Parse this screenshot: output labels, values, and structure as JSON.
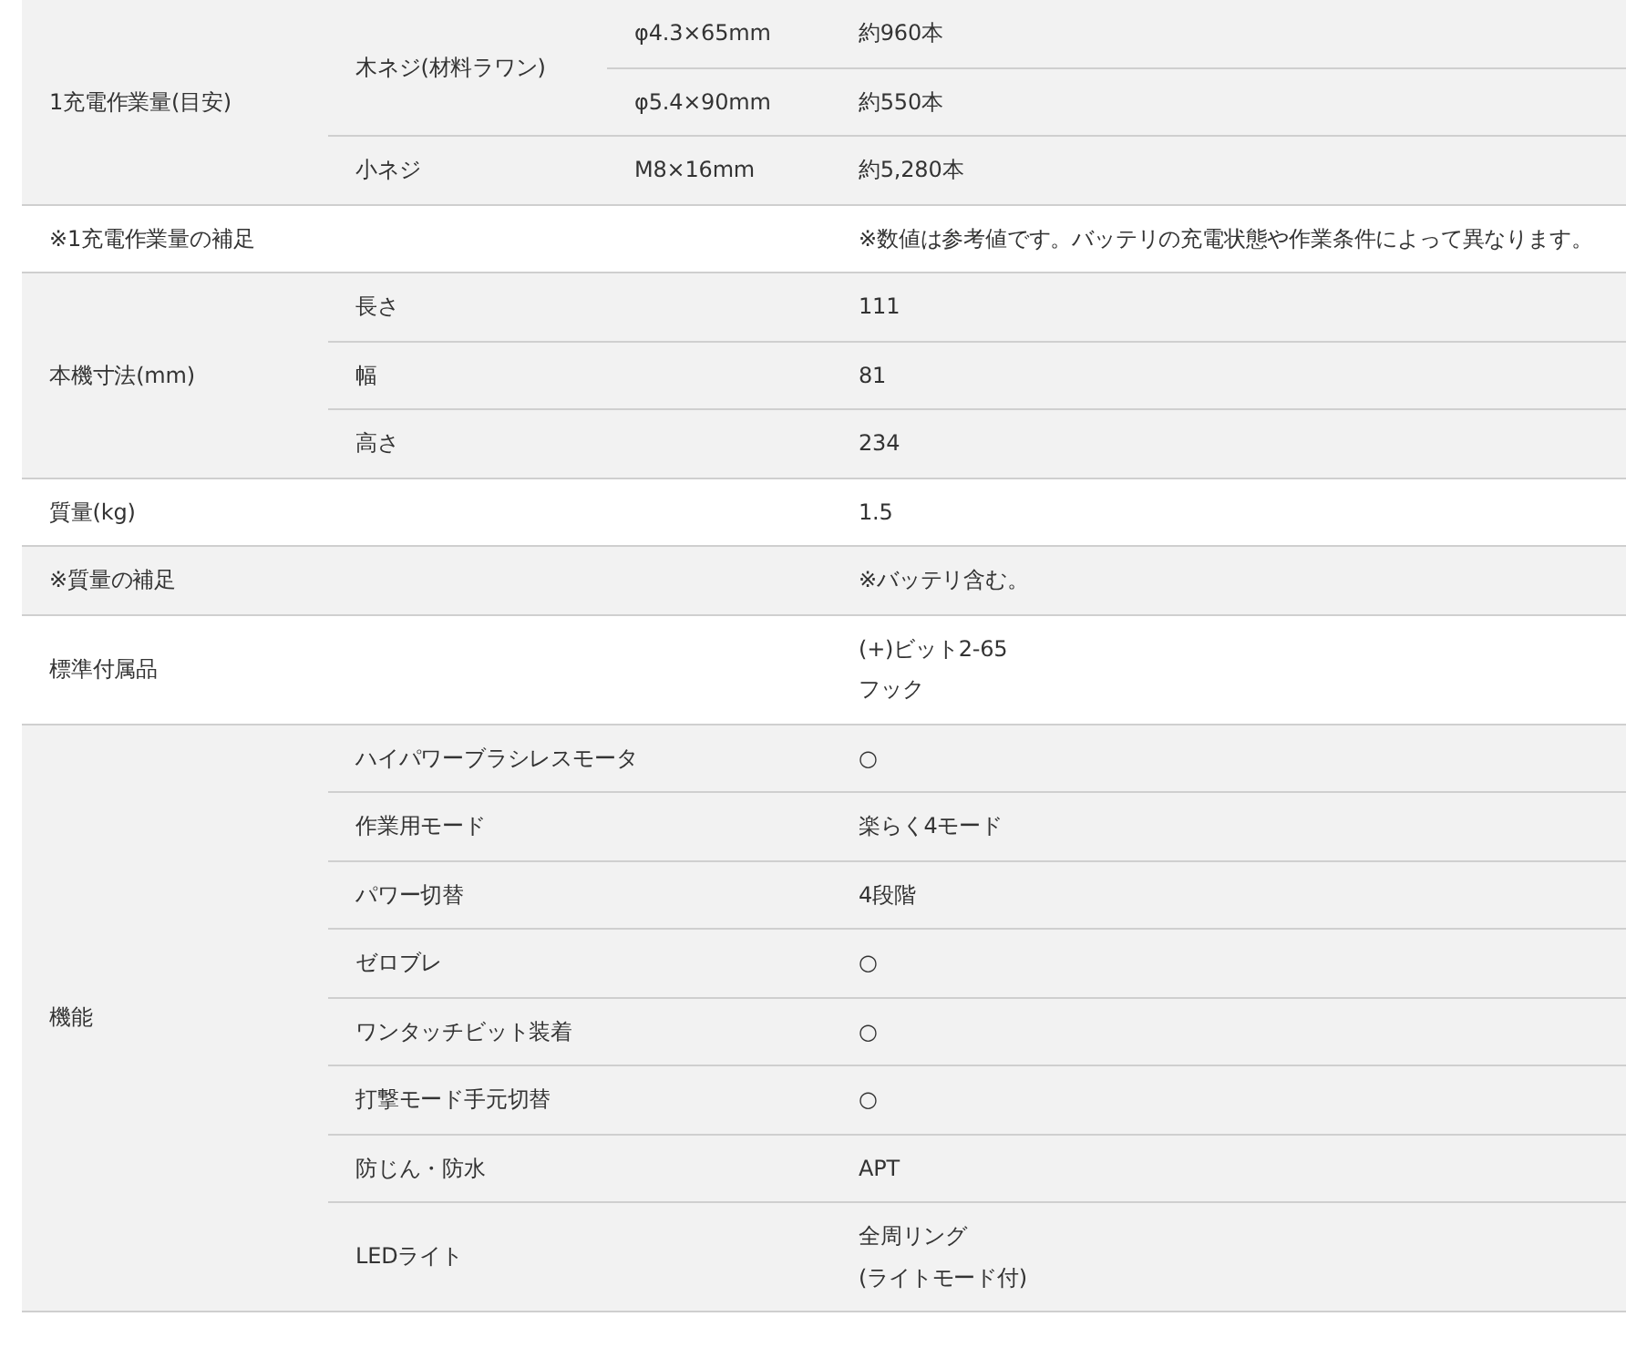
{
  "spec_table": {
    "rows": [
      {
        "label": "1充電作業量(目安)",
        "entries": [
          {
            "label": "木ネジ(材料ラワン)",
            "specs": [
              {
                "size": "φ4.3×65mm",
                "value": "約960本"
              },
              {
                "size": "φ5.4×90mm",
                "value": "約550本"
              }
            ]
          },
          {
            "label": "小ネジ",
            "specs": [
              {
                "size": "M8×16mm",
                "value": "約5,280本"
              }
            ]
          }
        ]
      },
      {
        "label": "※1充電作業量の補足",
        "values": [
          "※数値は参考値です。バッテリの充電状態や作業条件によって異なります。"
        ]
      },
      {
        "label": "本機寸法(mm)",
        "entries": [
          {
            "label": "長さ",
            "values": [
              "111"
            ]
          },
          {
            "label": "幅",
            "values": [
              "81"
            ]
          },
          {
            "label": "高さ",
            "values": [
              "234"
            ]
          }
        ]
      },
      {
        "label": "質量(kg)",
        "values": [
          "1.5"
        ]
      },
      {
        "label": "※質量の補足",
        "values": [
          "※バッテリ含む。"
        ]
      },
      {
        "label": "標準付属品",
        "values": [
          "(+)ビット2-65",
          "フック"
        ]
      },
      {
        "label": "機能",
        "entries": [
          {
            "label": "ハイパワーブラシレスモータ",
            "values": [
              "○"
            ]
          },
          {
            "label": "作業用モード",
            "values": [
              "楽らく4モード"
            ]
          },
          {
            "label": "パワー切替",
            "values": [
              "4段階"
            ]
          },
          {
            "label": "ゼロブレ",
            "values": [
              "○"
            ]
          },
          {
            "label": "ワンタッチビット装着",
            "values": [
              "○"
            ]
          },
          {
            "label": "打撃モード手元切替",
            "values": [
              "○"
            ]
          },
          {
            "label": "防じん・防水",
            "values": [
              "APT"
            ]
          },
          {
            "label": "LEDライト",
            "values": [
              "全周リング",
              "(ライトモード付)"
            ]
          }
        ]
      }
    ]
  }
}
